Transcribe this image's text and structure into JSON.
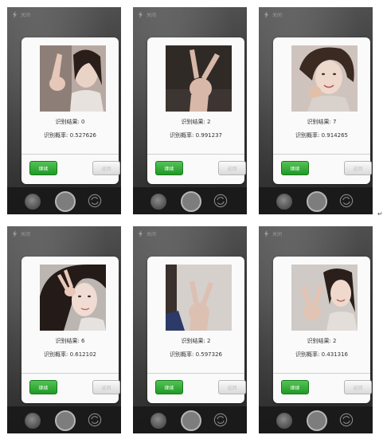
{
  "flash_label": "关闭",
  "result_prefix": "识别结果: ",
  "prob_prefix": "识别概率: ",
  "continue_label": "继续",
  "back_label": "返回",
  "return_mark": "↵",
  "colors": {
    "continue_green": "#2ea52f",
    "dialog_bg": "#fafafa",
    "camera_bar": "#191919"
  },
  "panels": [
    {
      "result": "识别结果: 0",
      "probability": "识别概率: 0.527626",
      "photo_desc": "woman hand near face"
    },
    {
      "result": "识别结果: 2",
      "probability": "识别概率: 0.991237",
      "photo_desc": "v sign hand"
    },
    {
      "result": "识别结果: 7",
      "probability": "识别概率: 0.914265",
      "photo_desc": "woman smiling"
    },
    {
      "result": "识别结果: 6",
      "probability": "识别概率: 0.612102",
      "photo_desc": "woman hand on head"
    },
    {
      "result": "识别结果: 2",
      "probability": "识别概率: 0.597326",
      "photo_desc": "v sign hand"
    },
    {
      "result": "识别结果: 2",
      "probability": "识别概率: 0.431316",
      "photo_desc": "woman v sign"
    }
  ]
}
